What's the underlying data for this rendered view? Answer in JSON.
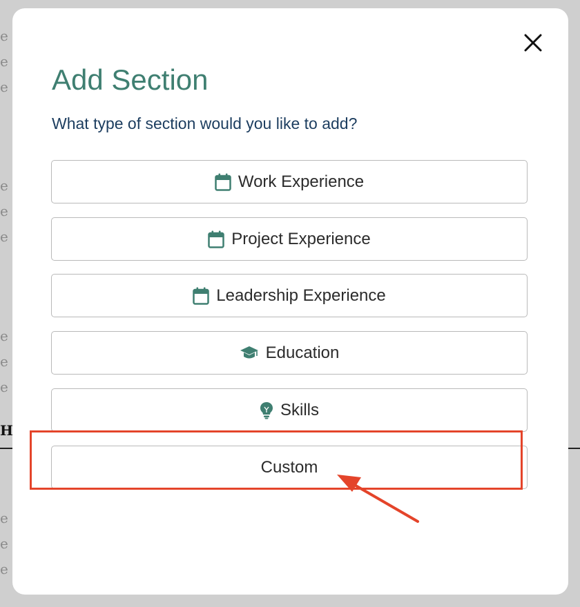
{
  "background": {
    "edge_chars": [
      "e",
      "e",
      "e",
      "e",
      "e",
      "e",
      "e",
      "e",
      "e",
      "e",
      "e",
      "e"
    ],
    "heading_fragment": "HI"
  },
  "modal": {
    "title": "Add Section",
    "subtitle": "What type of section would you like to add?",
    "close_icon": "close-icon",
    "options": [
      {
        "label": "Work Experience",
        "icon": "calendar-icon"
      },
      {
        "label": "Project Experience",
        "icon": "calendar-icon"
      },
      {
        "label": "Leadership Experience",
        "icon": "calendar-icon"
      },
      {
        "label": "Education",
        "icon": "graduation-cap-icon"
      },
      {
        "label": "Skills",
        "icon": "lightbulb-icon"
      },
      {
        "label": "Custom",
        "icon": ""
      }
    ]
  },
  "annotation": {
    "highlight_color": "#e4442a",
    "target": "Custom"
  },
  "colors": {
    "accent": "#3f7f71",
    "subtitle": "#1c3d5f",
    "icon": "#3f7f71"
  }
}
